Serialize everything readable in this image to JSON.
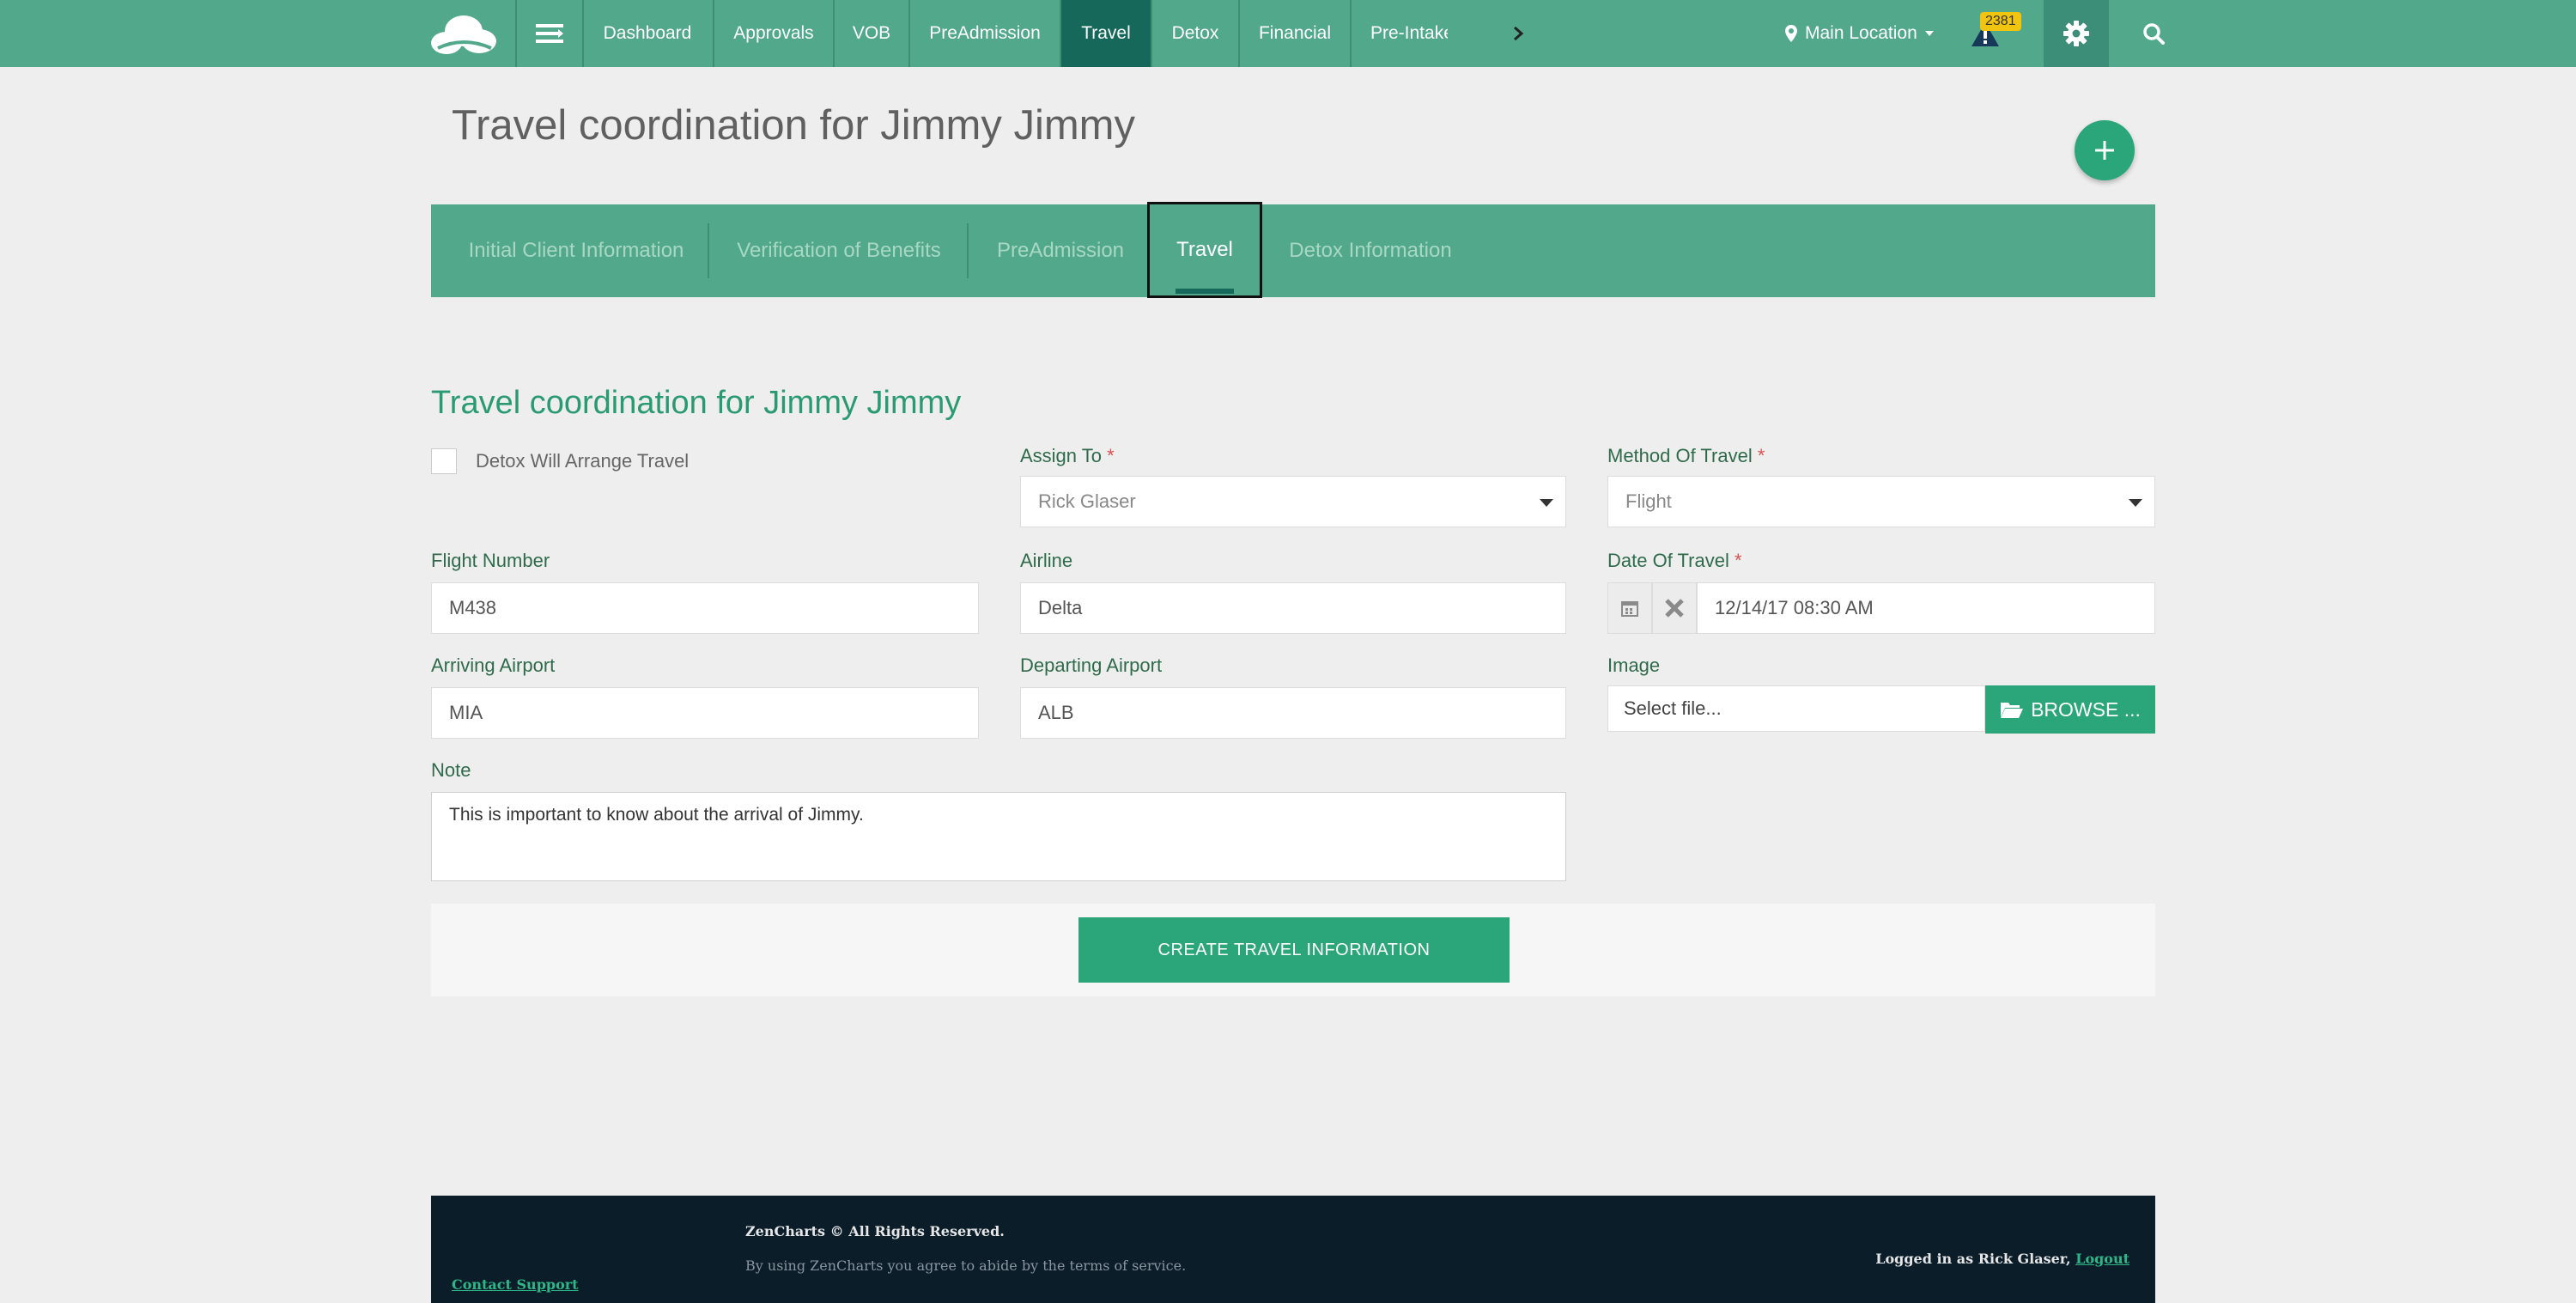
{
  "nav": {
    "items": [
      "Dashboard",
      "Approvals",
      "VOB",
      "PreAdmission",
      "Travel",
      "Detox",
      "Financial",
      "Pre-Intake"
    ],
    "active": "Travel",
    "location": "Main Location",
    "alert_count": "2381"
  },
  "page": {
    "title": "Travel coordination for Jimmy Jimmy"
  },
  "tabs": {
    "items": [
      "Initial Client Information",
      "Verification of Benefits",
      "PreAdmission",
      "Travel",
      "Detox Information"
    ],
    "active": "Travel"
  },
  "form": {
    "section_title": "Travel coordination for Jimmy Jimmy",
    "detox_arrange_label": "Detox Will Arrange Travel",
    "assign_to_label": "Assign To",
    "assign_to_value": "Rick Glaser",
    "method_label": "Method Of Travel",
    "method_value": "Flight",
    "flight_number_label": "Flight Number",
    "flight_number_value": "M438",
    "airline_label": "Airline",
    "airline_value": "Delta",
    "date_label": "Date Of Travel",
    "date_value": "12/14/17 08:30 AM",
    "arriving_label": "Arriving Airport",
    "arriving_value": "MIA",
    "departing_label": "Departing Airport",
    "departing_value": "ALB",
    "image_label": "Image",
    "image_placeholder": "Select file...",
    "browse_label": "BROWSE ...",
    "note_label": "Note",
    "note_value": "This is important to know about the arrival of Jimmy.",
    "required_mark": "*",
    "submit_label": "CREATE TRAVEL INFORMATION"
  },
  "footer": {
    "copyright": "ZenCharts © All Rights Reserved.",
    "terms": "By using ZenCharts you agree to abide by the terms of service.",
    "support": "Contact Support",
    "logged_in": "Logged in as Rick Glaser,",
    "logout": "Logout"
  },
  "colors": {
    "nav_green": "#52a88a",
    "active_dark": "#16695a",
    "accent": "#2aa67a",
    "footer_bg": "#0b1d29"
  }
}
